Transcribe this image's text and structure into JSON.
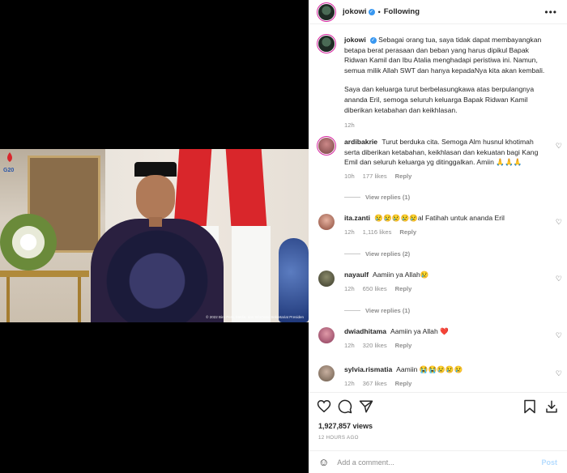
{
  "header": {
    "username": "jokowi",
    "follow_status": "Following",
    "more_icon": "more-horizontal-icon"
  },
  "caption": {
    "username": "jokowi",
    "paragraph1": "Sebagai orang tua, saya tidak dapat membayangkan betapa berat perasaan dan beban yang harus dipikul Bapak Ridwan Kamil dan Ibu Atalia menghadapi peristiwa ini. Namun, semua milik Allah SWT dan hanya kepadaNya kita akan kembali.",
    "paragraph2": "Saya dan keluarga turut berbelasungkawa atas berpulangnya ananda Eril, semoga seluruh keluarga Bapak Ridwan Kamil diberikan ketabahan dan keikhlasan.",
    "time": "12h"
  },
  "comments": [
    {
      "username": "ardibakrie",
      "text": "Turut berduka cita. Semoga Alm husnul khotimah serta diberikan ketabahan, keikhlasan dan kekuatan bagi Kang Emil dan seluruh keluarga yg ditinggalkan. Amiin 🙏🙏🙏",
      "time": "10h",
      "likes": "177 likes",
      "reply": "Reply",
      "view_replies": "View replies (1)"
    },
    {
      "username": "ita.zanti",
      "text": "😢😢😢😢😢al Fatihah untuk ananda Eril",
      "time": "12h",
      "likes": "1,116 likes",
      "reply": "Reply",
      "view_replies": "View replies (2)"
    },
    {
      "username": "nayaulf",
      "text": "Aamiin ya Allah😢",
      "time": "12h",
      "likes": "650 likes",
      "reply": "Reply",
      "view_replies": "View replies (1)"
    },
    {
      "username": "dwiadhitama",
      "text": "Aamiin ya Allah ❤️",
      "time": "12h",
      "likes": "320 likes",
      "reply": "Reply"
    },
    {
      "username": "sylvia.rismatia",
      "text": "Aamiin 😭😭😢😢😢",
      "time": "12h",
      "likes": "367 likes",
      "reply": "Reply"
    }
  ],
  "stats": {
    "views": "1,927,857 views",
    "posted_ago": "12 HOURS AGO"
  },
  "add_comment": {
    "placeholder": "Add a comment...",
    "post_label": "Post"
  },
  "media": {
    "watermark": "© 2022 Biro Pers, Media, dan Informasi Sekretariat Presiden"
  },
  "colors": {
    "accent": "#3897f0",
    "muted": "#8e8e8e",
    "post_disabled": "#b3dbff",
    "flag_red": "#d9262b"
  }
}
